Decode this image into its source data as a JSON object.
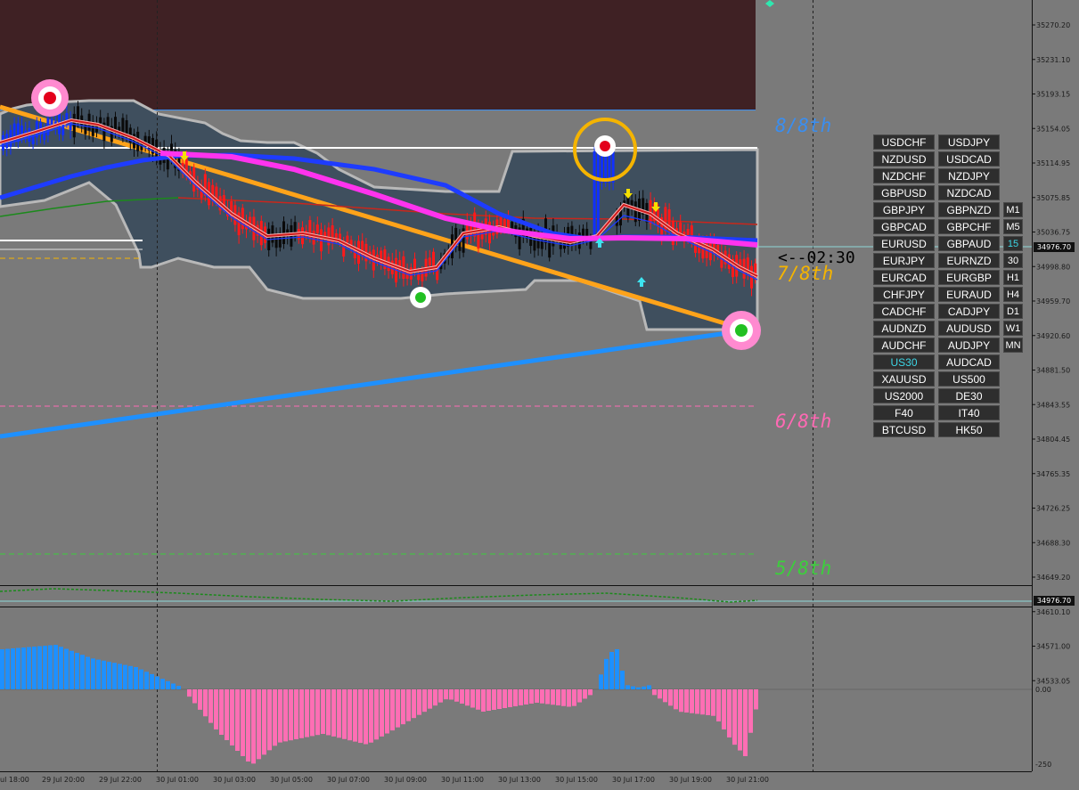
{
  "price_axis": {
    "labels": [
      "35270.20",
      "35231.10",
      "35193.15",
      "35154.05",
      "35114.95",
      "35075.85",
      "35036.75",
      "34998.80",
      "34959.70",
      "34920.60",
      "34881.50",
      "34843.55",
      "34804.45",
      "34765.35",
      "34726.25",
      "34688.30",
      "34649.20",
      "34610.10",
      "34571.00",
      "34533.05"
    ],
    "current_price": "34976.70"
  },
  "indicator_axis": {
    "labels": [
      "0.00",
      "-250"
    ],
    "current_value": "34976.70"
  },
  "time_axis": {
    "labels": [
      "ul 18:00",
      "29 Jul 20:00",
      "29 Jul 22:00",
      "30 Jul 01:00",
      "30 Jul 03:00",
      "30 Jul 05:00",
      "30 Jul 07:00",
      "30 Jul 09:00",
      "30 Jul 11:00",
      "30 Jul 13:00",
      "30 Jul 15:00",
      "30 Jul 17:00",
      "30 Jul 19:00",
      "30 Jul 21:00"
    ]
  },
  "murrey_levels": [
    {
      "label": "8/8th",
      "color": "#3a8ef0"
    },
    {
      "label": "7/8th",
      "color": "#f5b400"
    },
    {
      "label": "6/8th",
      "color": "#ff69b4"
    },
    {
      "label": "5/8th",
      "color": "#3ccf3c"
    }
  ],
  "countdown": "<--02:30",
  "symbols": {
    "left": [
      "USDCHF",
      "NZDUSD",
      "NZDCHF",
      "GBPUSD",
      "GBPJPY",
      "GBPCAD",
      "EURUSD",
      "EURJPY",
      "EURCAD",
      "CHFJPY",
      "CADCHF",
      "AUDNZD",
      "AUDCHF",
      "US30",
      "XAUUSD",
      "US2000",
      "F40",
      "BTCUSD"
    ],
    "right": [
      "USDJPY",
      "USDCAD",
      "NZDJPY",
      "NZDCAD",
      "GBPNZD",
      "GBPCHF",
      "GBPAUD",
      "EURNZD",
      "EURGBP",
      "EURAUD",
      "CADJPY",
      "AUDUSD",
      "AUDJPY",
      "AUDCAD",
      "US500",
      "DE30",
      "IT40",
      "HK50"
    ],
    "active": "US30"
  },
  "timeframes": {
    "items": [
      "M1",
      "M5",
      "15",
      "30",
      "H1",
      "H4",
      "D1",
      "W1",
      "MN"
    ],
    "active": "15"
  },
  "colors": {
    "bull_candle": "#0a0a0a",
    "bear_candle": "#ff1a1a",
    "blue_candle": "#1030ff",
    "histogram_positive": "#1e90ff",
    "histogram_negative": "#ff6eb4",
    "trend_orange": "#ffa31a",
    "trend_blue": "#1e90ff",
    "ma_magenta": "#ff33ee"
  }
}
